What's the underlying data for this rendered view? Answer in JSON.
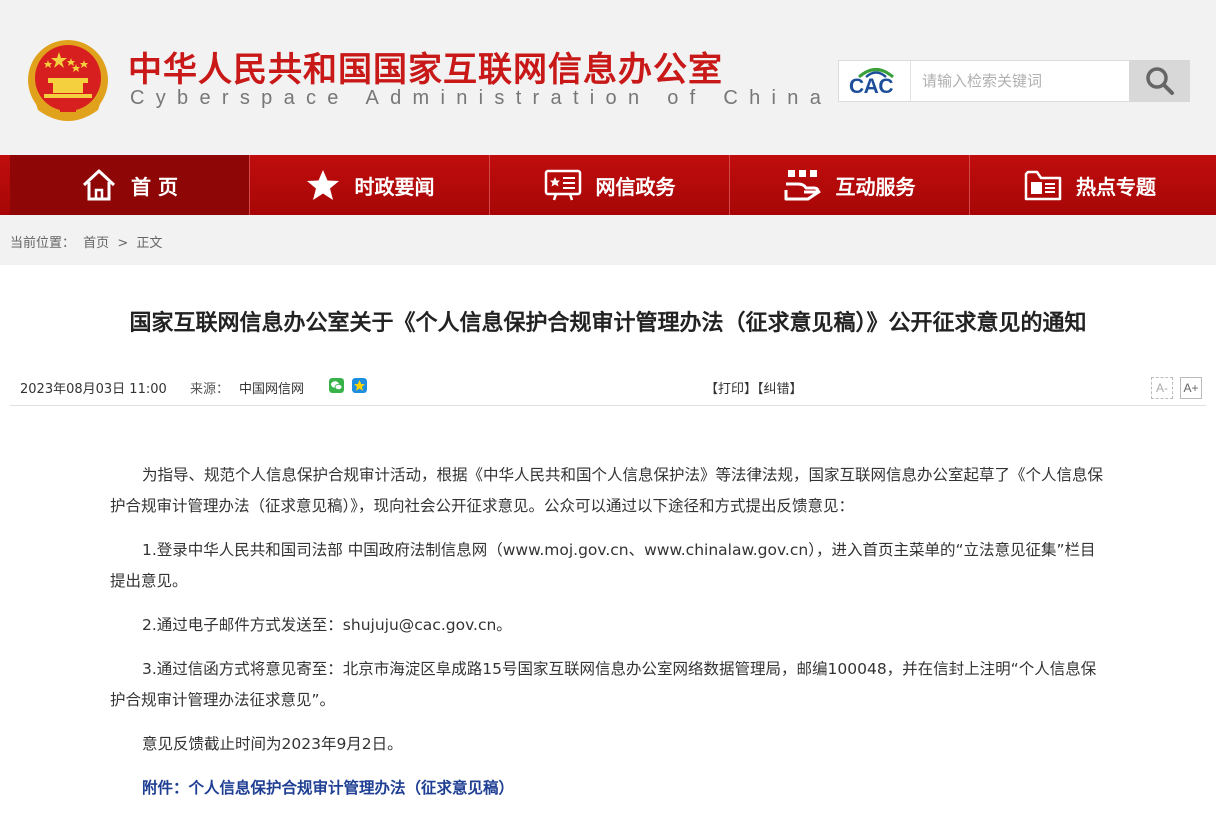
{
  "header": {
    "site_title": "中华人民共和国国家互联网信息办公室",
    "site_subtitle": "Cyberspace Administration of China",
    "logo_text": "CAC",
    "search_placeholder": "请输入检索关键词"
  },
  "nav": {
    "items": [
      {
        "label": "首 页",
        "icon": "home-icon"
      },
      {
        "label": "时政要闻",
        "icon": "star-icon"
      },
      {
        "label": "网信政务",
        "icon": "document-icon"
      },
      {
        "label": "互动服务",
        "icon": "hands-icon"
      },
      {
        "label": "热点专题",
        "icon": "folder-icon"
      }
    ]
  },
  "breadcrumb": {
    "label": "当前位置：",
    "home": "首页",
    "sep": ">",
    "current": "正文"
  },
  "article": {
    "title": "国家互联网信息办公室关于《个人信息保护合规审计管理办法（征求意见稿）》公开征求意见的通知",
    "date": "2023年08月03日 11:00",
    "source_label": "来源：",
    "source": "中国网信网",
    "print": "【打印】",
    "correct": "【纠错】",
    "font_smaller": "A-",
    "font_larger": "A+",
    "paragraphs": [
      "为指导、规范个人信息保护合规审计活动，根据《中华人民共和国个人信息保护法》等法律法规，国家互联网信息办公室起草了《个人信息保护合规审计管理办法（征求意见稿）》，现向社会公开征求意见。公众可以通过以下途径和方式提出反馈意见：",
      "1.登录中华人民共和国司法部 中国政府法制信息网（www.moj.gov.cn、www.chinalaw.gov.cn），进入首页主菜单的“立法意见征集”栏目提出意见。",
      "2.通过电子邮件方式发送至：shujuju@cac.gov.cn。",
      "3.通过信函方式将意见寄至：北京市海淀区阜成路15号国家互联网信息办公室网络数据管理局，邮编100048，并在信封上注明“个人信息保护合规审计管理办法征求意见”。",
      "意见反馈截止时间为2023年9月2日。"
    ],
    "attachment": "附件：个人信息保护合规审计管理办法（征求意见稿）"
  },
  "colors": {
    "brand_red": "#c81818",
    "nav_red": "#b40a0a",
    "link_blue": "#1f3f93"
  }
}
